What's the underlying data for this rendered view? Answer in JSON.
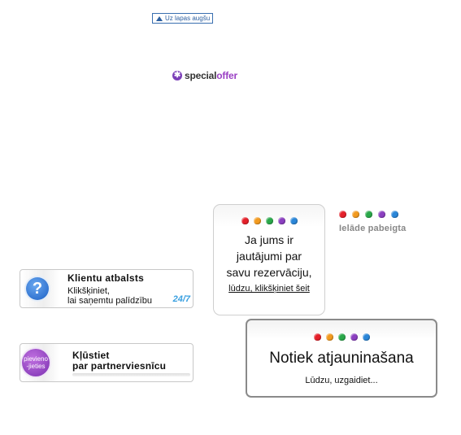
{
  "back_to_top": {
    "label": "Uz lapas augšu"
  },
  "special_offer": {
    "word1": "special",
    "word2": "offer"
  },
  "question_card": {
    "text_lines": [
      "Ja jums ir",
      "jautājumi par",
      "savu rezervāciju,"
    ],
    "link": "lūdzu, klikšķiniet šeit"
  },
  "loading": {
    "label": "Ielāde pabeigta"
  },
  "support": {
    "title": "Klientu atbalsts",
    "line1": "Klikšķiniet,",
    "line2": "lai saņemtu palīdzību",
    "badge": "24/7",
    "icon": "question-icon"
  },
  "partner": {
    "icon_text": "pievieno-jieties",
    "title_line1": "Kļūstiet",
    "title_line2": "par partnerviesnīcu"
  },
  "updating": {
    "title": "Notiek atjauninašana",
    "subtitle": "Lūdzu, uzgaidiet..."
  },
  "dot_colors": [
    "#e5202a",
    "#f29a1f",
    "#2aa84a",
    "#8b3fc0",
    "#2a86d8"
  ]
}
